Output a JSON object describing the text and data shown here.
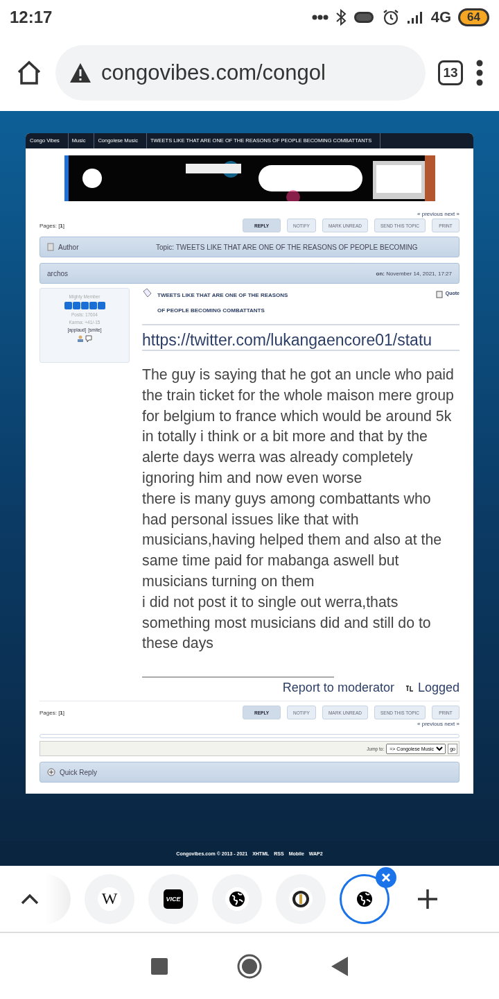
{
  "status_bar": {
    "time": "12:17",
    "network": "4G",
    "battery": "64"
  },
  "address_bar": {
    "url": "congovibes.com/congol",
    "tab_count": "13"
  },
  "breadcrumb": [
    "Congo Vibes",
    "Music",
    "Congolese Music",
    "TWEETS LIKE THAT ARE ONE OF THE REASONS OF PEOPLE BECOMING COMBATTANTS"
  ],
  "ad": {
    "kind": "picture"
  },
  "pager_top": {
    "nav": "« previous next »",
    "pages_label": "Pages: [",
    "page": "1",
    "pages_end": "]",
    "buttons": [
      {
        "label": "REPLY",
        "selected": true
      },
      {
        "label": "NOTIFY",
        "selected": false
      },
      {
        "label": "MARK UNREAD",
        "selected": false
      },
      {
        "label": "SEND THIS TOPIC",
        "selected": false
      },
      {
        "label": "PRINT",
        "selected": false
      }
    ]
  },
  "topic_header": {
    "author": "Author",
    "topic": "Topic: TWEETS LIKE THAT ARE ONE OF THE REASONS OF PEOPLE BECOMING"
  },
  "post": {
    "author": "archos",
    "date_label": "on:",
    "date": "November 14, 2021, 17:27",
    "profile": {
      "rank": "Mighty Member",
      "stars": 5,
      "posts": "Posts: 17604",
      "karma": "Karma: +41/-15",
      "applaud": "[applaud]",
      "smite": "[smite]"
    },
    "subject": [
      "TWEETS LIKE THAT ARE ONE OF THE REASONS",
      "OF PEOPLE BECOMING COMBATTANTS"
    ],
    "quote": "Quote",
    "link": "https://twitter.com/lukangaencore01/statu",
    "body": [
      "The guy is saying that he got an uncle who paid the train ticket for the whole maison mere group for belgium to france which would be around 5k in totally i think or a bit more  and that by the alerte days werra was already completely ignoring him and now even worse",
      "there is many guys among combattants who had personal issues like that with musicians,having helped them and also at the same time paid for mabanga aswell but musicians turning on them",
      "i did not post it to single out werra,thats something most musicians did and still do to these days"
    ],
    "report": "Report to moderator",
    "logged": "Logged"
  },
  "pager_bottom": {
    "nav": "« previous next »",
    "pages_label": "Pages: [",
    "page": "1",
    "pages_end": "]",
    "buttons": [
      {
        "label": "REPLY",
        "selected": true
      },
      {
        "label": "NOTIFY",
        "selected": false
      },
      {
        "label": "MARK UNREAD",
        "selected": false
      },
      {
        "label": "SEND THIS TOPIC",
        "selected": false
      },
      {
        "label": "PRINT",
        "selected": false
      }
    ]
  },
  "jump": {
    "label": "Jump to:",
    "value": "=> Congolese Music",
    "go": "go"
  },
  "quick_reply": "Quick Reply",
  "footer": [
    "Congovibes.com © 2013 - 2021",
    "XHTML",
    "RSS",
    "Mobile",
    "WAP2"
  ],
  "tabs": [
    {
      "kind": "wiki",
      "text": "W",
      "selected": false
    },
    {
      "kind": "vice",
      "text": "VICE",
      "selected": false
    },
    {
      "kind": "globe",
      "selected": false
    },
    {
      "kind": "badge",
      "selected": false
    },
    {
      "kind": "globe",
      "selected": true
    }
  ]
}
